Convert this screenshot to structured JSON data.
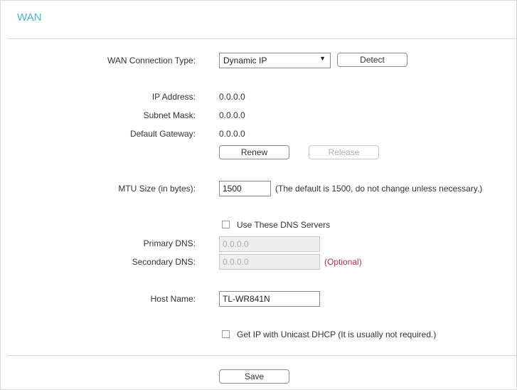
{
  "page": {
    "title": "WAN"
  },
  "wan": {
    "connection_type_label": "WAN Connection Type:",
    "connection_type_value": "Dynamic IP",
    "detect_label": "Detect",
    "ip_address_label": "IP Address:",
    "ip_address_value": "0.0.0.0",
    "subnet_mask_label": "Subnet Mask:",
    "subnet_mask_value": "0.0.0.0",
    "gateway_label": "Default Gateway:",
    "gateway_value": "0.0.0.0",
    "renew_label": "Renew",
    "release_label": "Release",
    "mtu_label": "MTU Size (in bytes):",
    "mtu_value": "1500",
    "mtu_hint": "(The default is 1500, do not change unless necessary.)",
    "dns_checkbox_label": "Use These DNS Servers",
    "primary_dns_label": "Primary DNS:",
    "primary_dns_value": "0.0.0.0",
    "secondary_dns_label": "Secondary DNS:",
    "secondary_dns_value": "0.0.0.0",
    "optional_label": "(Optional)",
    "host_name_label": "Host Name:",
    "host_name_value": "TL-WR841N",
    "unicast_checkbox_label": "Get IP with Unicast DHCP (It is usually not required.)",
    "save_label": "Save"
  },
  "colors": {
    "title": "#4eb6c0",
    "optional": "#a8324a",
    "border": "#d9d9d9"
  },
  "icons": {
    "select_arrow": "caret-down-icon"
  }
}
